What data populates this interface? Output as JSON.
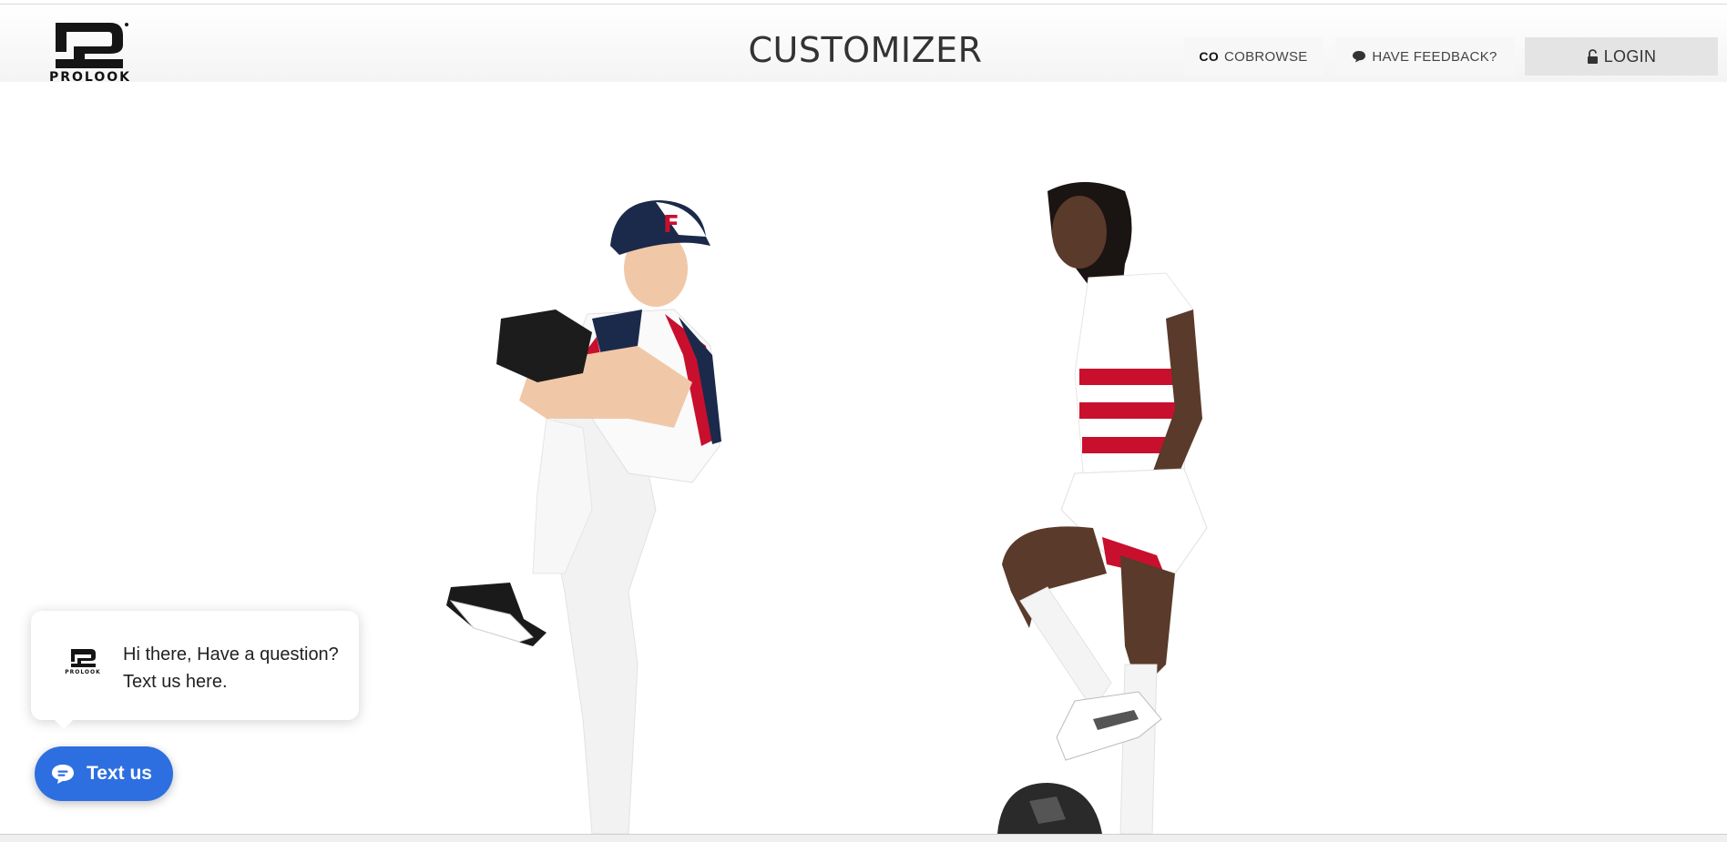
{
  "header": {
    "logo_text": "PROLOOK",
    "title": "CUSTOMIZER",
    "cobrowse": {
      "icon": "co-icon",
      "icon_text": "CO",
      "label": "COBROWSE"
    },
    "feedback": {
      "icon": "speech-bubble-icon",
      "label": "HAVE FEEDBACK?"
    },
    "login": {
      "icon": "unlock-icon",
      "label": "LOGIN"
    }
  },
  "hero": {
    "figures": [
      "baseball-player-photo",
      "soccer-player-photo"
    ]
  },
  "chat": {
    "logo_text": "PROLOOK",
    "message": "Hi there, Have a question? Text us here.",
    "button_icon": "chat-icon",
    "button_label": "Text us"
  },
  "colors": {
    "accent_blue": "#2d6fe0",
    "login_bg": "#e4e4e4",
    "jersey_red": "#c8102e",
    "jersey_navy": "#1b2a4a"
  }
}
